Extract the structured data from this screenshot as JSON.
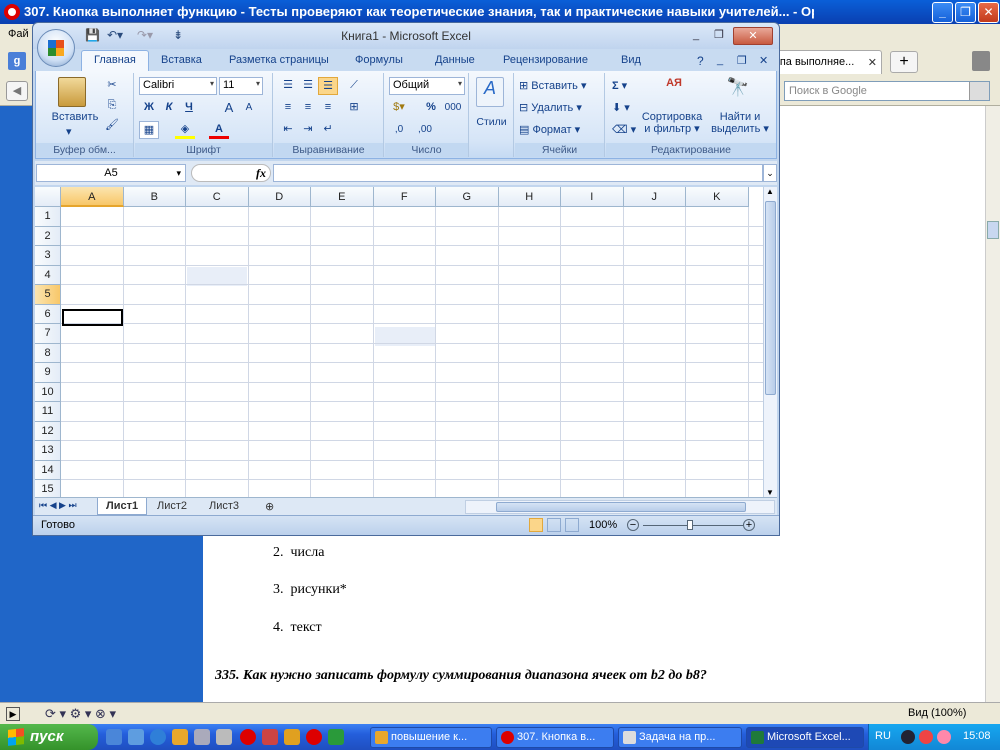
{
  "opera": {
    "title": "307. Кнопка выполняет функцию - Тесты проверяют как теоретические знания, так и практические навыки учителей... - Opera",
    "menu_label": "Фай",
    "active_tab_label": "кпа выполняе...",
    "search_placeholder": "Поиск в Google",
    "zoom_label": "Вид (100%)"
  },
  "document": {
    "answers": [
      {
        "num": "2.",
        "text": "числа"
      },
      {
        "num": "3.",
        "text": "рисунки*"
      },
      {
        "num": "4.",
        "text": "текст"
      }
    ],
    "question": "335. Как нужно записать формулу суммирования диапазона ячеек от b2 до b8?"
  },
  "excel": {
    "title": "Книга1 - Microsoft Excel",
    "tabs": [
      "Главная",
      "Вставка",
      "Разметка страницы",
      "Формулы",
      "Данные",
      "Рецензирование",
      "Вид"
    ],
    "ribbon": {
      "clipboard": {
        "paste": "Вставить",
        "label": "Буфер обм..."
      },
      "font": {
        "name": "Calibri",
        "size": "11",
        "bold": "Ж",
        "italic": "К",
        "underline": "Ч",
        "grow": "A",
        "shrink": "A",
        "color": "A",
        "label": "Шрифт"
      },
      "alignment": {
        "label": "Выравнивание"
      },
      "number": {
        "format": "Общий",
        "percent": "%",
        "thousands": "000",
        "inc": ",0",
        "dec": ",00",
        "label": "Число"
      },
      "styles": {
        "label": "Стили"
      },
      "cells": {
        "insert": "Вставить",
        "delete": "Удалить",
        "format": "Формат",
        "label": "Ячейки"
      },
      "editing": {
        "sigma": "Σ",
        "sort": "Сортировка",
        "sort2": "и фильтр",
        "find": "Найти и",
        "find2": "выделить",
        "label": "Редактирование"
      }
    },
    "namebox": "A5",
    "fx": "fx",
    "columns": [
      "A",
      "B",
      "C",
      "D",
      "E",
      "F",
      "G",
      "H",
      "I",
      "J",
      "K"
    ],
    "rows": [
      "1",
      "2",
      "3",
      "4",
      "5",
      "6",
      "7",
      "8",
      "9",
      "10",
      "11",
      "12",
      "13",
      "14",
      "15"
    ],
    "sheets": [
      "Лист1",
      "Лист2",
      "Лист3"
    ],
    "status": "Готово",
    "zoom": "100%"
  },
  "taskbar": {
    "start": "пуск",
    "buttons": [
      "повышение к...",
      "307. Кнопка в...",
      "Задача на пр...",
      "Microsoft Excel..."
    ],
    "lang": "RU",
    "time": "15:08"
  }
}
